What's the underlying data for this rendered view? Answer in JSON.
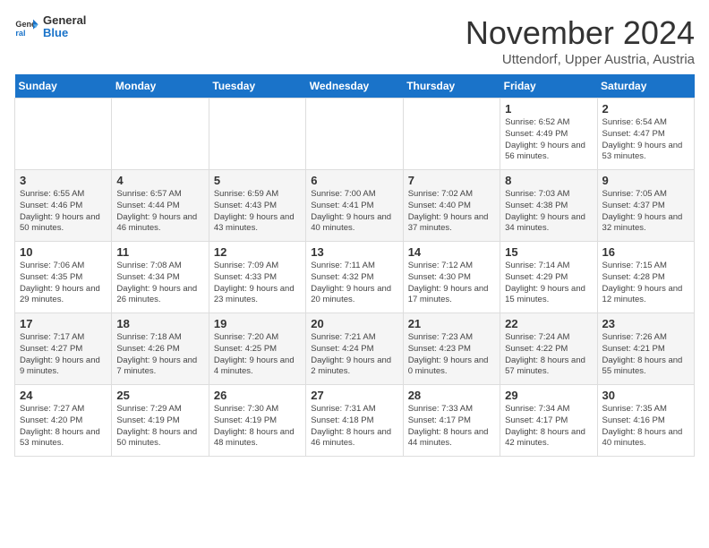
{
  "logo": {
    "line1": "General",
    "line2": "Blue"
  },
  "title": "November 2024",
  "location": "Uttendorf, Upper Austria, Austria",
  "days_of_week": [
    "Sunday",
    "Monday",
    "Tuesday",
    "Wednesday",
    "Thursday",
    "Friday",
    "Saturday"
  ],
  "weeks": [
    [
      {
        "day": "",
        "detail": ""
      },
      {
        "day": "",
        "detail": ""
      },
      {
        "day": "",
        "detail": ""
      },
      {
        "day": "",
        "detail": ""
      },
      {
        "day": "",
        "detail": ""
      },
      {
        "day": "1",
        "detail": "Sunrise: 6:52 AM\nSunset: 4:49 PM\nDaylight: 9 hours and 56 minutes."
      },
      {
        "day": "2",
        "detail": "Sunrise: 6:54 AM\nSunset: 4:47 PM\nDaylight: 9 hours and 53 minutes."
      }
    ],
    [
      {
        "day": "3",
        "detail": "Sunrise: 6:55 AM\nSunset: 4:46 PM\nDaylight: 9 hours and 50 minutes."
      },
      {
        "day": "4",
        "detail": "Sunrise: 6:57 AM\nSunset: 4:44 PM\nDaylight: 9 hours and 46 minutes."
      },
      {
        "day": "5",
        "detail": "Sunrise: 6:59 AM\nSunset: 4:43 PM\nDaylight: 9 hours and 43 minutes."
      },
      {
        "day": "6",
        "detail": "Sunrise: 7:00 AM\nSunset: 4:41 PM\nDaylight: 9 hours and 40 minutes."
      },
      {
        "day": "7",
        "detail": "Sunrise: 7:02 AM\nSunset: 4:40 PM\nDaylight: 9 hours and 37 minutes."
      },
      {
        "day": "8",
        "detail": "Sunrise: 7:03 AM\nSunset: 4:38 PM\nDaylight: 9 hours and 34 minutes."
      },
      {
        "day": "9",
        "detail": "Sunrise: 7:05 AM\nSunset: 4:37 PM\nDaylight: 9 hours and 32 minutes."
      }
    ],
    [
      {
        "day": "10",
        "detail": "Sunrise: 7:06 AM\nSunset: 4:35 PM\nDaylight: 9 hours and 29 minutes."
      },
      {
        "day": "11",
        "detail": "Sunrise: 7:08 AM\nSunset: 4:34 PM\nDaylight: 9 hours and 26 minutes."
      },
      {
        "day": "12",
        "detail": "Sunrise: 7:09 AM\nSunset: 4:33 PM\nDaylight: 9 hours and 23 minutes."
      },
      {
        "day": "13",
        "detail": "Sunrise: 7:11 AM\nSunset: 4:32 PM\nDaylight: 9 hours and 20 minutes."
      },
      {
        "day": "14",
        "detail": "Sunrise: 7:12 AM\nSunset: 4:30 PM\nDaylight: 9 hours and 17 minutes."
      },
      {
        "day": "15",
        "detail": "Sunrise: 7:14 AM\nSunset: 4:29 PM\nDaylight: 9 hours and 15 minutes."
      },
      {
        "day": "16",
        "detail": "Sunrise: 7:15 AM\nSunset: 4:28 PM\nDaylight: 9 hours and 12 minutes."
      }
    ],
    [
      {
        "day": "17",
        "detail": "Sunrise: 7:17 AM\nSunset: 4:27 PM\nDaylight: 9 hours and 9 minutes."
      },
      {
        "day": "18",
        "detail": "Sunrise: 7:18 AM\nSunset: 4:26 PM\nDaylight: 9 hours and 7 minutes."
      },
      {
        "day": "19",
        "detail": "Sunrise: 7:20 AM\nSunset: 4:25 PM\nDaylight: 9 hours and 4 minutes."
      },
      {
        "day": "20",
        "detail": "Sunrise: 7:21 AM\nSunset: 4:24 PM\nDaylight: 9 hours and 2 minutes."
      },
      {
        "day": "21",
        "detail": "Sunrise: 7:23 AM\nSunset: 4:23 PM\nDaylight: 9 hours and 0 minutes."
      },
      {
        "day": "22",
        "detail": "Sunrise: 7:24 AM\nSunset: 4:22 PM\nDaylight: 8 hours and 57 minutes."
      },
      {
        "day": "23",
        "detail": "Sunrise: 7:26 AM\nSunset: 4:21 PM\nDaylight: 8 hours and 55 minutes."
      }
    ],
    [
      {
        "day": "24",
        "detail": "Sunrise: 7:27 AM\nSunset: 4:20 PM\nDaylight: 8 hours and 53 minutes."
      },
      {
        "day": "25",
        "detail": "Sunrise: 7:29 AM\nSunset: 4:19 PM\nDaylight: 8 hours and 50 minutes."
      },
      {
        "day": "26",
        "detail": "Sunrise: 7:30 AM\nSunset: 4:19 PM\nDaylight: 8 hours and 48 minutes."
      },
      {
        "day": "27",
        "detail": "Sunrise: 7:31 AM\nSunset: 4:18 PM\nDaylight: 8 hours and 46 minutes."
      },
      {
        "day": "28",
        "detail": "Sunrise: 7:33 AM\nSunset: 4:17 PM\nDaylight: 8 hours and 44 minutes."
      },
      {
        "day": "29",
        "detail": "Sunrise: 7:34 AM\nSunset: 4:17 PM\nDaylight: 8 hours and 42 minutes."
      },
      {
        "day": "30",
        "detail": "Sunrise: 7:35 AM\nSunset: 4:16 PM\nDaylight: 8 hours and 40 minutes."
      }
    ]
  ]
}
